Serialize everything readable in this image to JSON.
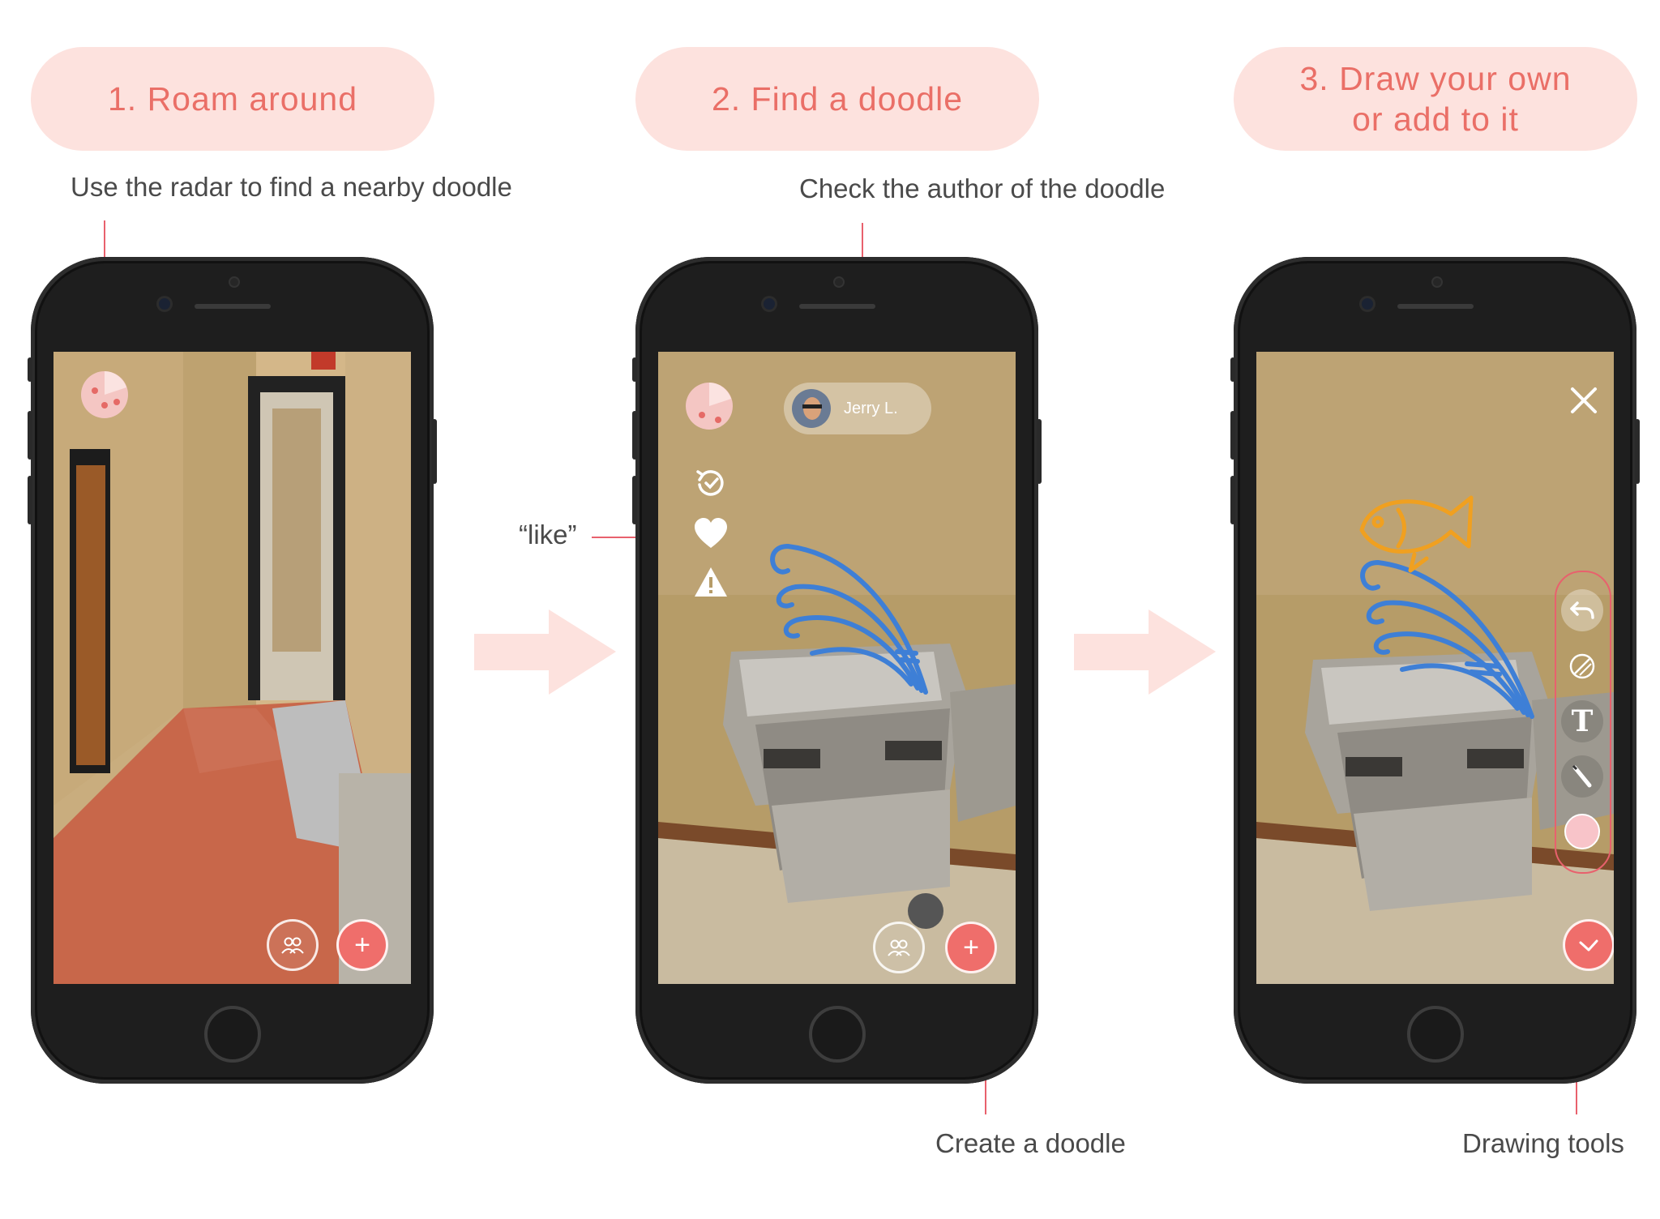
{
  "steps": [
    {
      "label": "1. Roam around"
    },
    {
      "label": "2. Find a doodle"
    },
    {
      "label_line1": "3. Draw your own",
      "label_line2": "or add to it"
    }
  ],
  "captions": {
    "radar": "Use the radar to find a nearby doodle",
    "author": "Check the author of the doodle",
    "like": "“like”",
    "create": "Create a doodle",
    "tools": "Drawing tools"
  },
  "author_chip": {
    "name": "Jerry L."
  },
  "icons": {
    "radar": "radar-icon",
    "people": "people-icon",
    "plus": "plus-icon",
    "history": "history-icon",
    "heart": "heart-icon",
    "warning": "warning-icon",
    "close": "close-icon",
    "undo": "undo-icon",
    "eraser": "eraser-icon",
    "text": "text-icon",
    "pen": "pen-icon",
    "color": "color-swatch-icon",
    "check": "check-icon"
  },
  "colors": {
    "pill_bg": "#fde2de",
    "pill_text": "#ea6f67",
    "accent": "#ef6e6b",
    "leader": "#e8616d",
    "doodle_blue": "#3e7fd6",
    "doodle_orange": "#f0a020"
  }
}
